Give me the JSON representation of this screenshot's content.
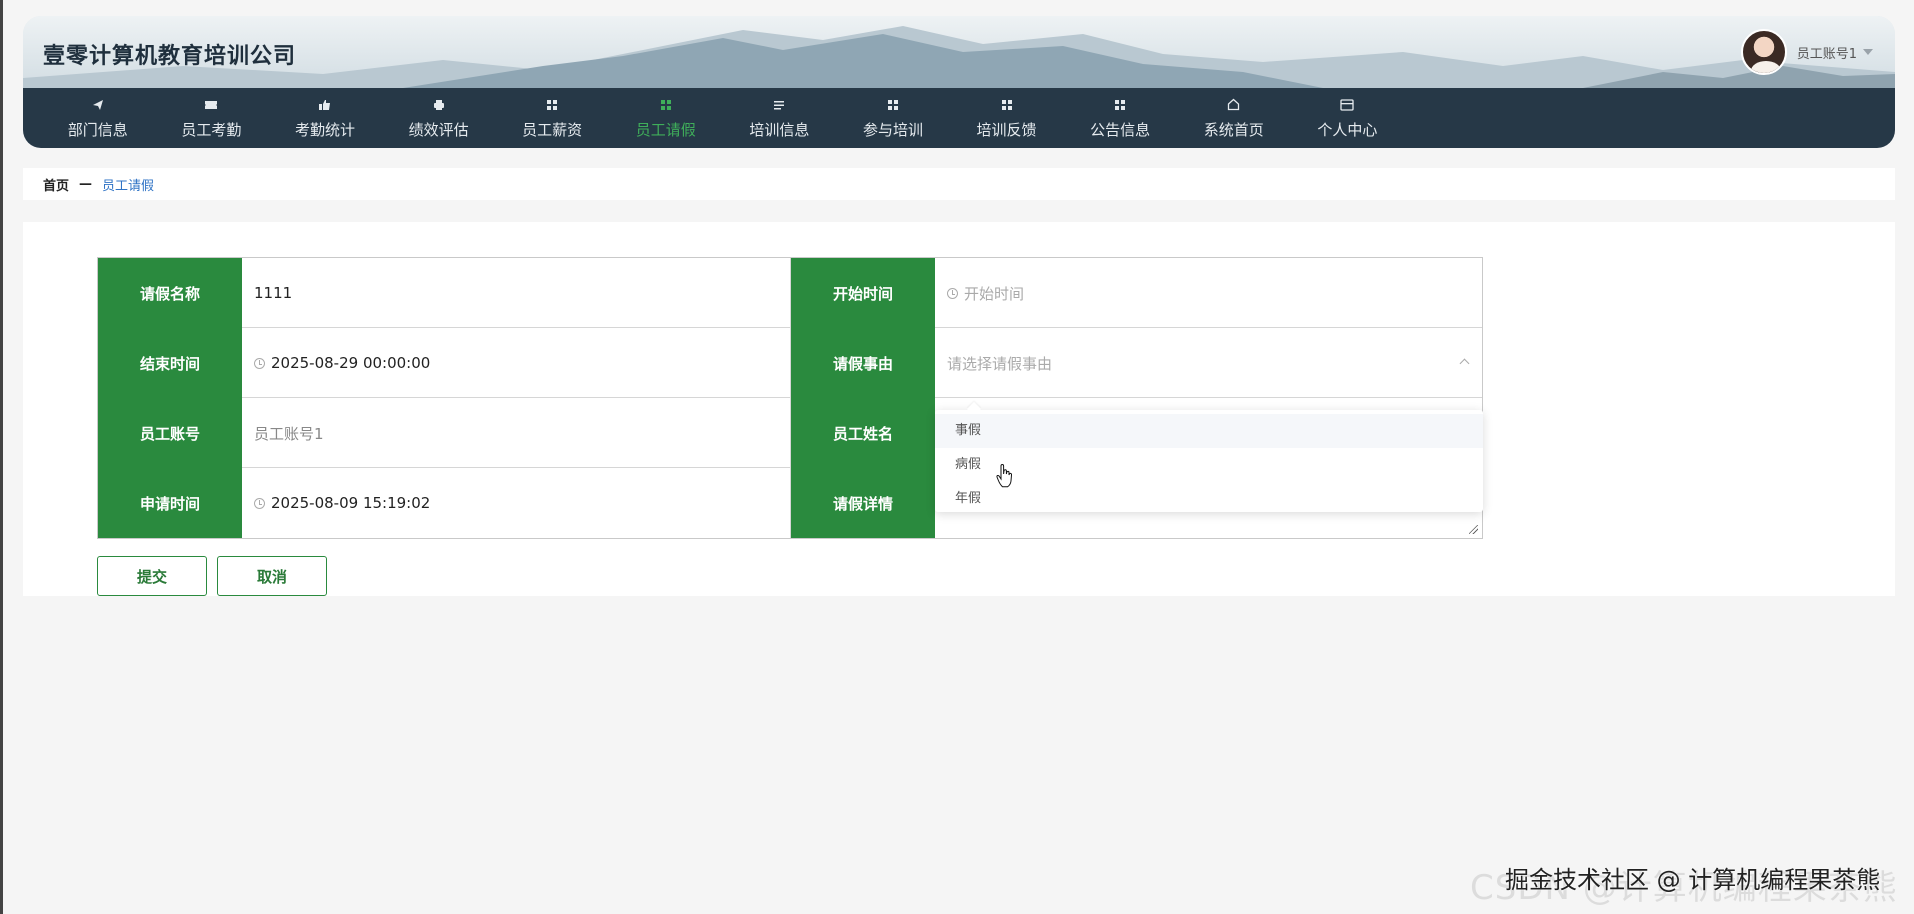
{
  "header": {
    "title": "壹零计算机教育培训公司",
    "user_name": "员工账号1"
  },
  "nav": {
    "items": [
      {
        "label": "部门信息",
        "icon": "send-icon"
      },
      {
        "label": "员工考勤",
        "icon": "ticket-icon"
      },
      {
        "label": "考勤统计",
        "icon": "thumbs-up-icon"
      },
      {
        "label": "绩效评估",
        "icon": "printer-icon"
      },
      {
        "label": "员工薪资",
        "icon": "grid-icon"
      },
      {
        "label": "员工请假",
        "icon": "grid-icon"
      },
      {
        "label": "培训信息",
        "icon": "list-icon"
      },
      {
        "label": "参与培训",
        "icon": "grid-icon"
      },
      {
        "label": "培训反馈",
        "icon": "grid-icon"
      },
      {
        "label": "公告信息",
        "icon": "grid-icon"
      },
      {
        "label": "系统首页",
        "icon": "home-icon"
      },
      {
        "label": "个人中心",
        "icon": "card-icon"
      }
    ],
    "active_label": "员工请假",
    "active_color": "#3fae5a"
  },
  "breadcrumb": {
    "home": "首页",
    "separator": "—",
    "current": "员工请假"
  },
  "form": {
    "leave_name": {
      "label": "请假名称",
      "value": "1111"
    },
    "start_time": {
      "label": "开始时间",
      "placeholder": "开始时间"
    },
    "end_time": {
      "label": "结束时间",
      "value": "2025-08-29 00:00:00"
    },
    "leave_reason": {
      "label": "请假事由",
      "placeholder": "请选择请假事由",
      "options": [
        "事假",
        "病假",
        "年假"
      ]
    },
    "employee_account": {
      "label": "员工账号",
      "value": "员工账号1"
    },
    "employee_name": {
      "label": "员工姓名",
      "value": ""
    },
    "apply_time": {
      "label": "申请时间",
      "value": "2025-08-09 15:19:02"
    },
    "leave_details": {
      "label": "请假详情",
      "value": ""
    }
  },
  "buttons": {
    "submit": "提交",
    "cancel": "取消"
  },
  "colors": {
    "label_bg": "#2a8a3e",
    "nav_bg": "#263847",
    "link": "#2f73c5"
  },
  "watermark": {
    "ghost": "CSDN @计算机编程果茶熊",
    "text": "掘金技术社区 @ 计算机编程果茶熊"
  }
}
